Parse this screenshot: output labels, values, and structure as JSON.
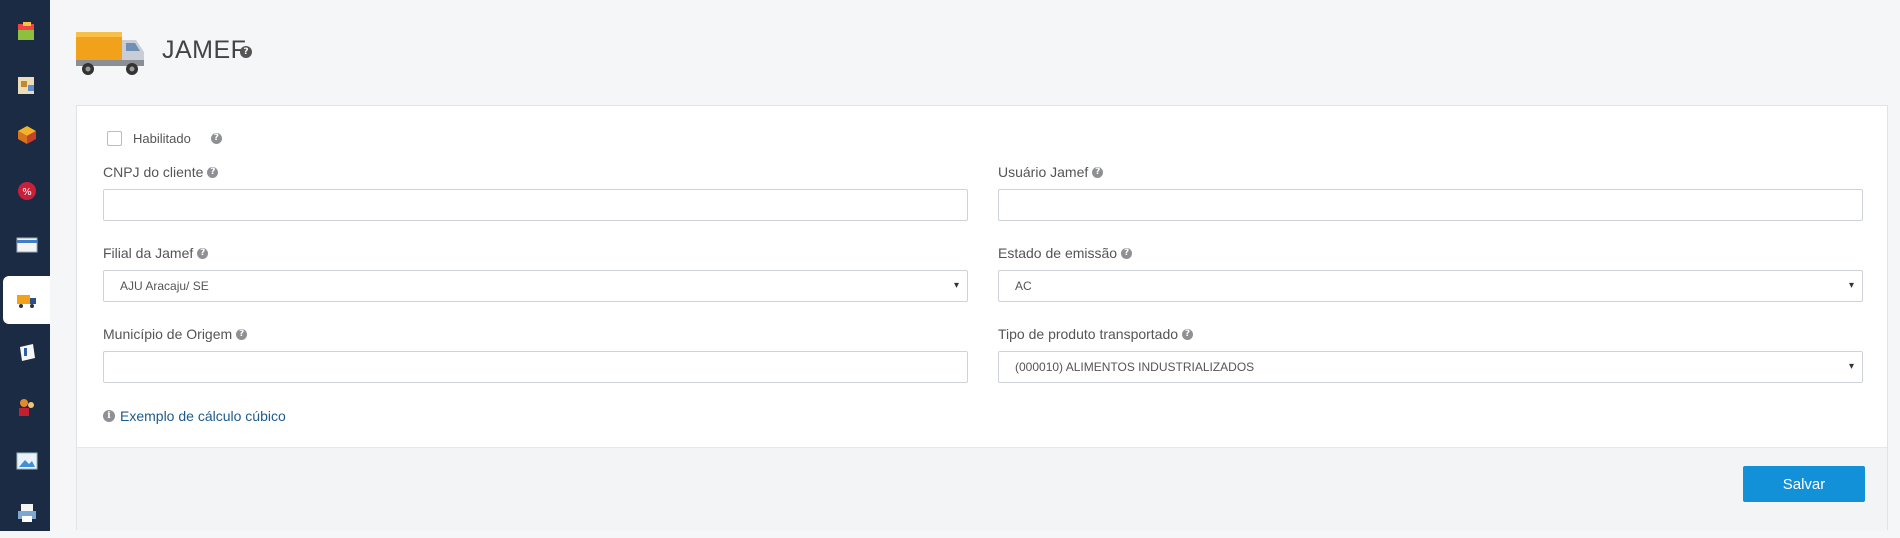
{
  "header": {
    "title": "JAMEF",
    "logo_icon": "truck-icon",
    "help_glyph": "?"
  },
  "sidebar": {
    "items": [
      {
        "icon": "box-icon"
      },
      {
        "icon": "products-icon"
      },
      {
        "icon": "package-icon"
      },
      {
        "icon": "discount-icon"
      },
      {
        "icon": "card-icon"
      },
      {
        "icon": "truck-icon",
        "active": true
      },
      {
        "icon": "document-icon"
      },
      {
        "icon": "users-icon"
      },
      {
        "icon": "image-icon"
      },
      {
        "icon": "print-icon"
      }
    ]
  },
  "form": {
    "enabled_label": "Habilitado",
    "enabled_checked": false,
    "cnpj_label": "CNPJ do cliente",
    "cnpj_value": "",
    "user_label": "Usuário Jamef",
    "user_value": "",
    "branch_label": "Filial da Jamef",
    "branch_value": "AJU Aracaju/ SE",
    "state_label": "Estado de emissão",
    "state_value": "AC",
    "city_label": "Município de Origem",
    "city_value": "",
    "product_label": "Tipo de produto transportado",
    "product_value": "(000010) ALIMENTOS INDUSTRIALIZADOS",
    "example_link": "Exemplo de cálculo cúbico",
    "info_glyph": "i",
    "select_arrow": "▾"
  },
  "footer": {
    "save_label": "Salvar"
  },
  "colors": {
    "sidebar": "#1b2b44",
    "primary": "#1391d8",
    "link": "#1e5a8c"
  }
}
